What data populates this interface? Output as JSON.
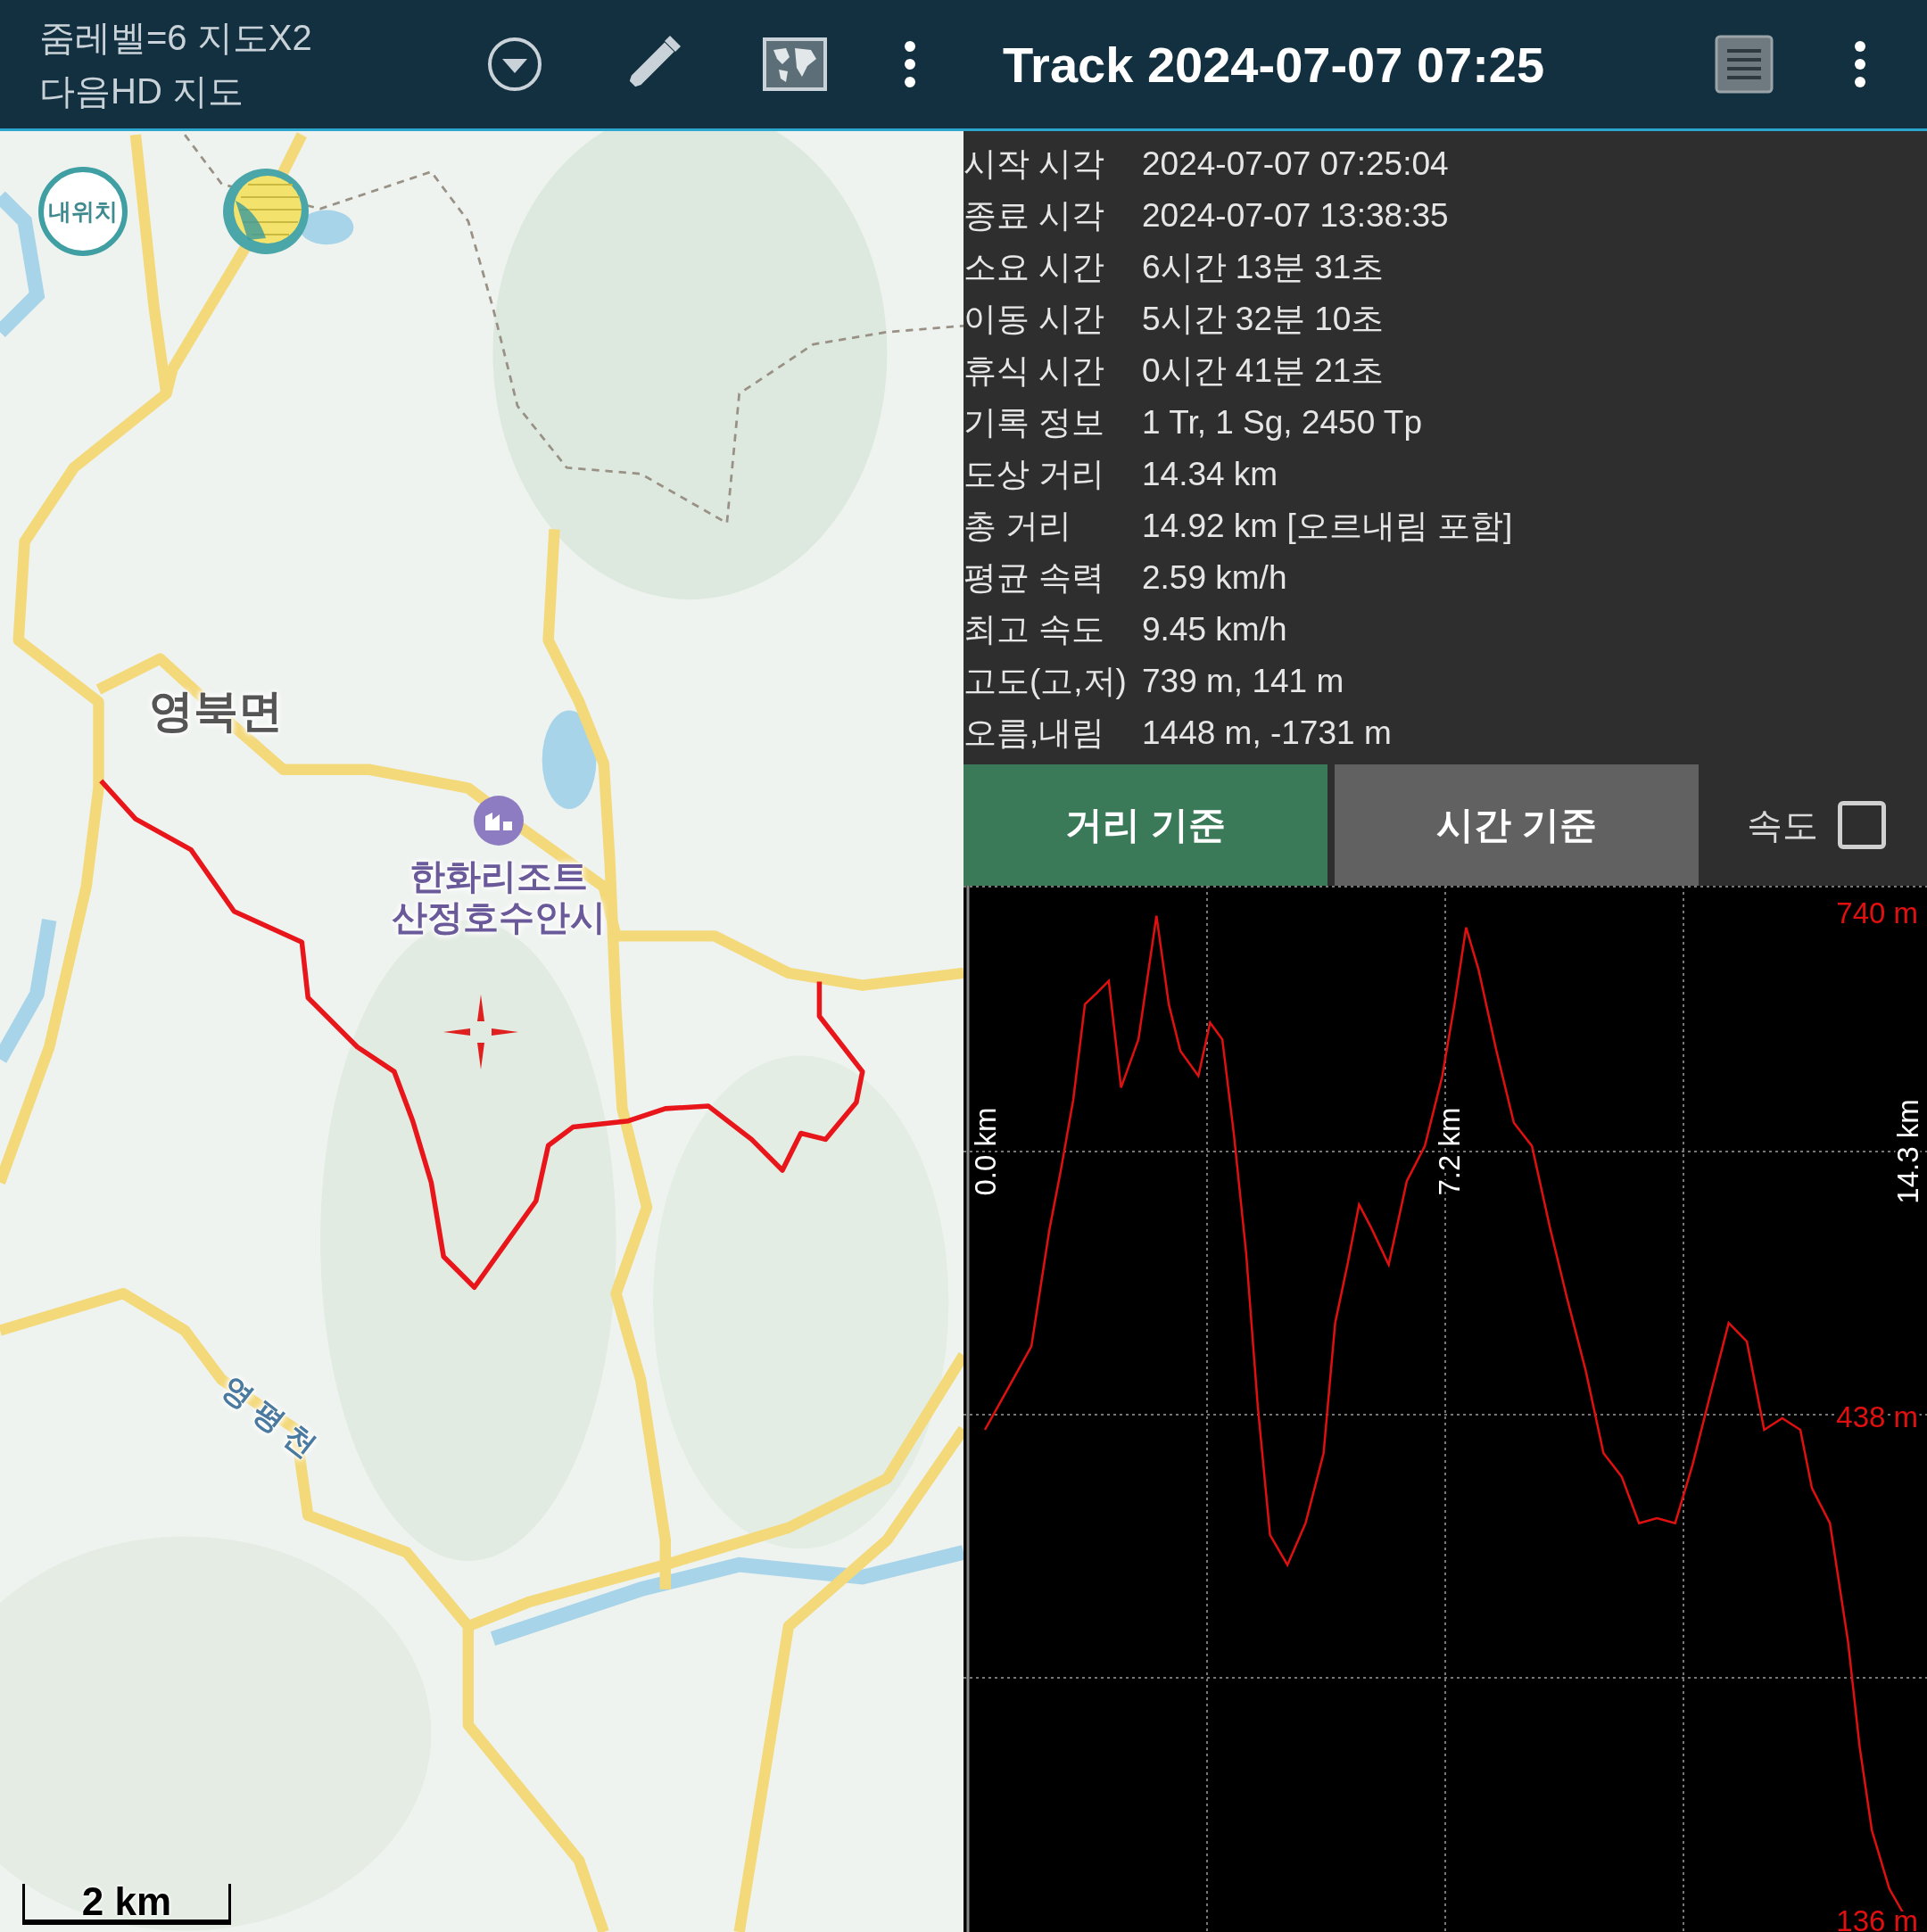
{
  "header": {
    "map_info": [
      "줌레벨=6 지도X2",
      "다음HD 지도"
    ],
    "title": "Track 2024-07-07 07:25"
  },
  "map": {
    "my_location_button": "내위치",
    "scale": "2 km",
    "labels": [
      {
        "kind": "place",
        "lines": [
          "영북면"
        ]
      },
      {
        "kind": "poi",
        "lines": [
          "한화리조트",
          "산정호수안시"
        ]
      },
      {
        "kind": "river",
        "lines": [
          "영평천"
        ]
      }
    ]
  },
  "stats": [
    {
      "label": "시작 시각",
      "value": "2024-07-07 07:25:04"
    },
    {
      "label": "종료 시각",
      "value": "2024-07-07 13:38:35"
    },
    {
      "label": "소요 시간",
      "value": "6시간 13분 31초"
    },
    {
      "label": "이동 시간",
      "value": "5시간 32분 10초"
    },
    {
      "label": "휴식 시간",
      "value": "0시간 41분 21초"
    },
    {
      "label": "기록 정보",
      "value": "1 Tr, 1 Sg, 2450 Tp"
    },
    {
      "label": "도상 거리",
      "value": "14.34 km"
    },
    {
      "label": "총 거리",
      "value": "14.92 km [오르내림 포함]"
    },
    {
      "label": "평균 속력",
      "value": "2.59 km/h"
    },
    {
      "label": "최고 속도",
      "value": "9.45 km/h"
    },
    {
      "label": "고도(고,저)",
      "value": "739 m, 141 m"
    },
    {
      "label": "오름,내림",
      "value": "1448 m, -1731 m"
    }
  ],
  "modes": [
    {
      "label": "거리 기준",
      "selected": true
    },
    {
      "label": "시간 기준",
      "selected": false
    }
  ],
  "speed_toggle": {
    "label": "속도",
    "checked": false
  },
  "elevation_chart": {
    "chart_data": {
      "type": "line",
      "x": [
        0,
        0.26,
        0.72,
        1.0,
        1.18,
        1.37,
        1.55,
        1.74,
        1.92,
        2.11,
        2.38,
        2.66,
        2.85,
        3.03,
        3.31,
        3.49,
        3.68,
        3.86,
        4.05,
        4.23,
        4.42,
        4.69,
        4.97,
        5.25,
        5.43,
        5.62,
        5.8,
        5.99,
        6.26,
        6.54,
        6.82,
        7.09,
        7.28,
        7.46,
        7.65,
        7.93,
        8.2,
        8.48,
        8.76,
        9.03,
        9.31,
        9.59,
        9.87,
        10.14,
        10.42,
        10.7,
        10.97,
        11.25,
        11.53,
        11.81,
        12.08,
        12.36,
        12.64,
        12.82,
        13.1,
        13.38,
        13.56,
        13.75,
        14.02,
        14.3
      ],
      "series": [
        {
          "color": "#e01010",
          "values": [
            430,
            448,
            480,
            550,
            586,
            628,
            685,
            692,
            699,
            635,
            664,
            738,
            685,
            657,
            642,
            674,
            664,
            607,
            536,
            444,
            367,
            349,
            374,
            416,
            494,
            529,
            565,
            551,
            529,
            579,
            600,
            642,
            685,
            731,
            706,
            657,
            614,
            600,
            551,
            508,
            466,
            416,
            402,
            374,
            377,
            374,
            409,
            452,
            494,
            483,
            430,
            437,
            430,
            395,
            374,
            303,
            240,
            190,
            155,
            136
          ]
        }
      ],
      "xlim": [
        0,
        14.3
      ],
      "ylim": [
        136,
        740
      ],
      "xticks": [
        {
          "value": 0,
          "label": "0.0 km"
        },
        {
          "value": 7.2,
          "label": "7.2 km"
        },
        {
          "value": 14.3,
          "label": "14.3 km"
        }
      ],
      "yticks": [
        {
          "value": 740,
          "label": "740 m"
        },
        {
          "value": 438,
          "label": "438 m"
        },
        {
          "value": 136,
          "label": "136 m"
        }
      ]
    }
  }
}
